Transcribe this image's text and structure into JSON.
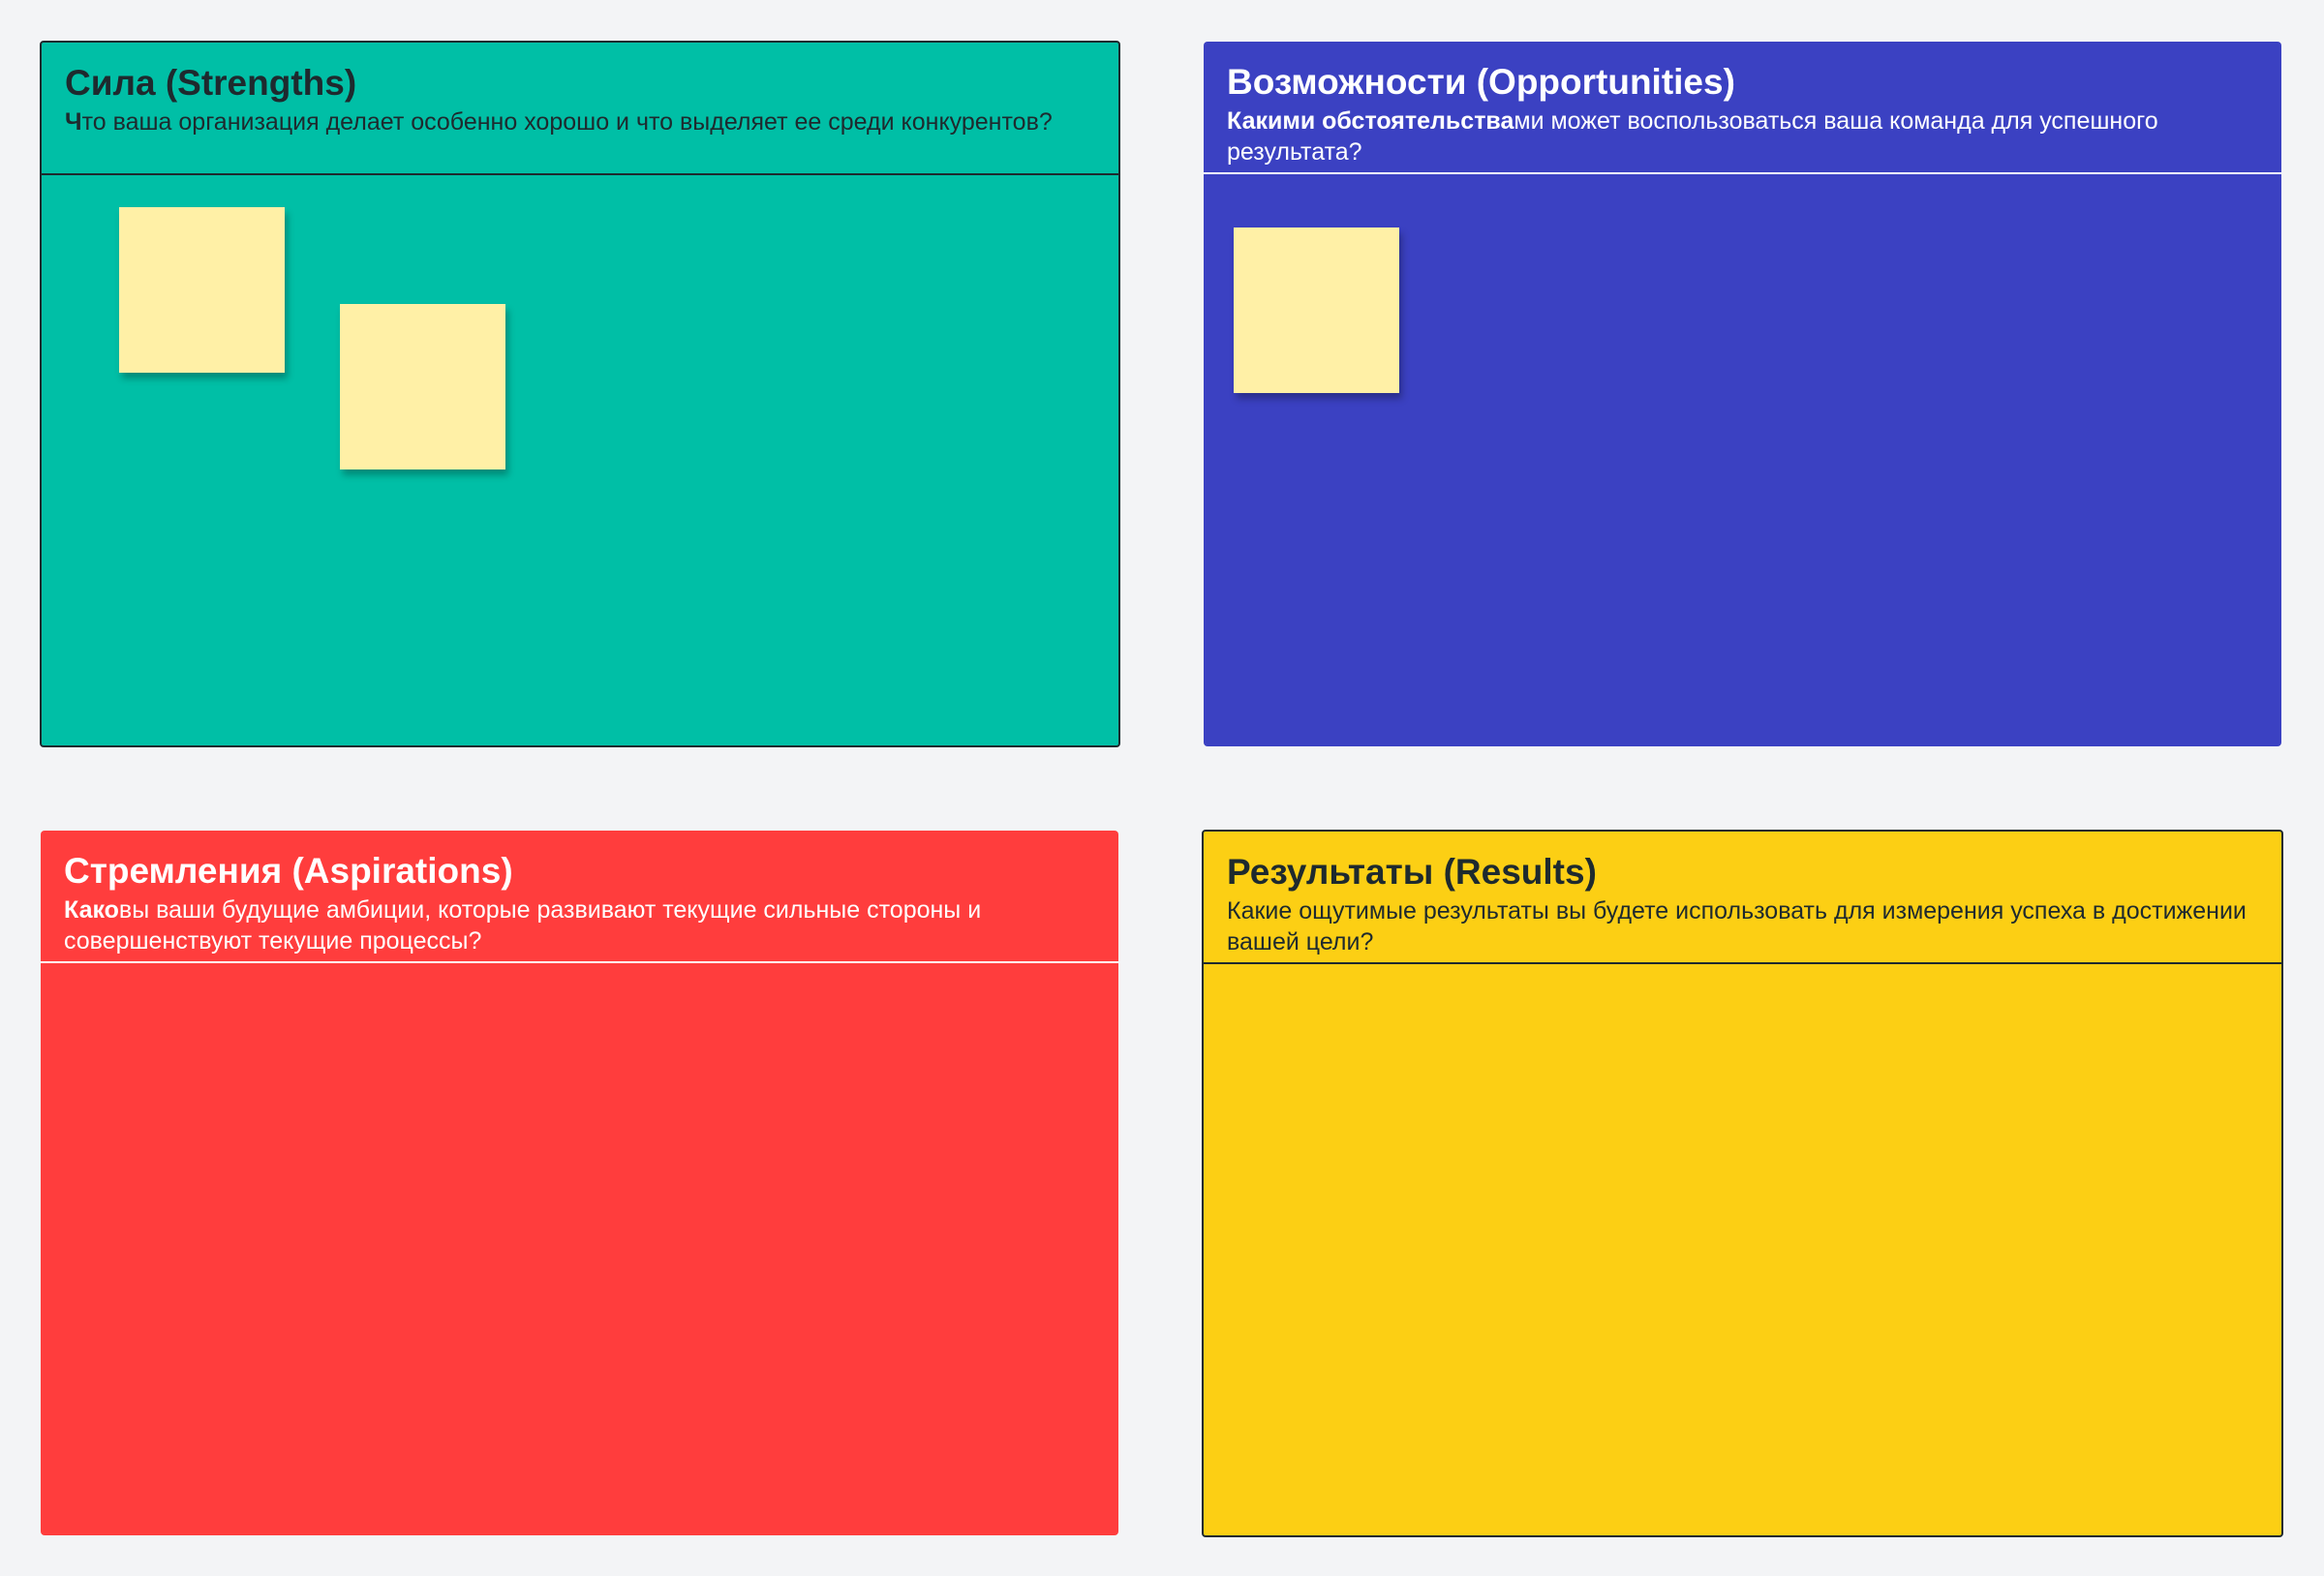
{
  "board": {
    "frames": {
      "strengths": {
        "title": "Сила (Strengths)",
        "desc_bold": "Ч",
        "desc_rest": "то ваша организация делает особенно хорошо и что выделяет ее среди конкурентов?",
        "background": "#00BFA6",
        "text_color": "#1E2A2E",
        "sticky_notes": 2
      },
      "opportunities": {
        "title": "Возможности (Opportunities)",
        "desc_bold": "Какими обстоятельства",
        "desc_rest": "ми может воспользоваться ваша команда для успешного результата?",
        "background": "#3B41C2",
        "text_color": "#FFFFFF",
        "sticky_notes": 1
      },
      "aspirations": {
        "title": "Стремления (Aspirations)",
        "desc_bold": "Како",
        "desc_rest": "вы ваши будущие амбиции, которые развивают текущие сильные стороны и совершенствуют текущие процессы?",
        "background": "#FF3D3D",
        "text_color": "#FFFFFF",
        "sticky_notes": 0
      },
      "results": {
        "title": "Результаты (Results)",
        "desc_bold": "",
        "desc_rest": "Какие ощутимые результаты вы будете использовать для измерения успеха в достижении вашей цели?",
        "background": "#FCCF14",
        "text_color": "#1E2A2E",
        "sticky_notes": 0
      }
    },
    "sticky_color": "#FFF0A6",
    "canvas_background": "#F3F4F6"
  }
}
